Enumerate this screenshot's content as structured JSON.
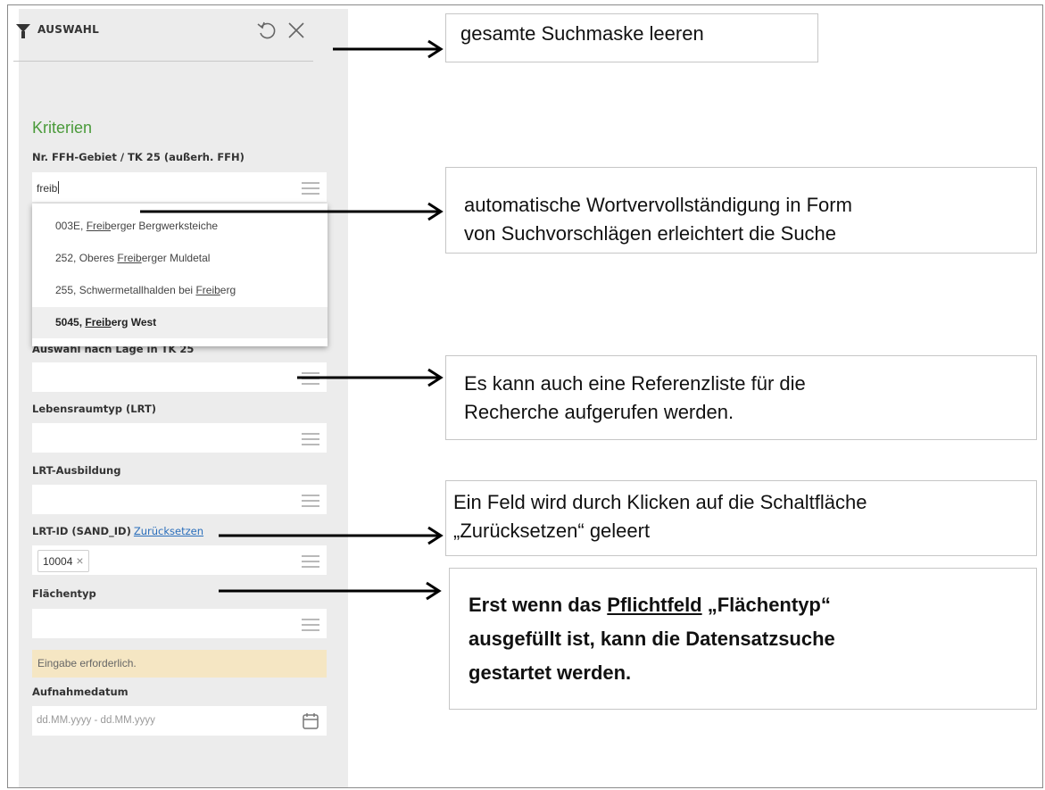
{
  "panel": {
    "title": "AUSWAHL",
    "section_title": "Kriterien"
  },
  "fields": {
    "ffh": {
      "label": "Nr. FFH-Gebiet / TK 25 (außerh. FFH)",
      "value": "freib"
    },
    "lage": {
      "label": "Auswahl nach Lage in TK 25"
    },
    "lrt": {
      "label": "Lebensraumtyp (LRT)"
    },
    "ausbildung": {
      "label": "LRT-Ausbildung"
    },
    "lrt_id": {
      "label": "LRT-ID (SAND_ID)",
      "reset_link": "Zurücksetzen",
      "chip": "10004",
      "chip_remove": "×"
    },
    "flaechentyp": {
      "label": "Flächentyp"
    },
    "warning": "Eingabe erforderlich.",
    "aufnahmedatum": {
      "label": "Aufnahmedatum",
      "placeholder": "dd.MM.yyyy - dd.MM.yyyy"
    }
  },
  "suggestions": [
    {
      "prefix": "003E, ",
      "match": "Freib",
      "suffix": "erger Bergwerksteiche"
    },
    {
      "prefix": "252, Oberes ",
      "match": "Freib",
      "suffix": "erger Muldetal"
    },
    {
      "prefix": "255, Schwermetallhalden bei ",
      "match": "Freib",
      "suffix": "erg"
    },
    {
      "prefix": "5045, ",
      "match": "Freib",
      "suffix": "erg West"
    }
  ],
  "callouts": {
    "clear": "gesamte Suchmaske leeren",
    "autocomplete_line1": "automatische Wortvervollständigung in Form",
    "autocomplete_line2": "von Suchvorschlägen erleichtert die Suche",
    "reflist_line1": "Es kann auch eine Referenzliste für die",
    "reflist_line2": "Recherche aufgerufen werden.",
    "reset_line1": "Ein Feld wird durch Klicken auf die Schaltfläche",
    "reset_line2": "„Zurücksetzen“ geleert",
    "required_pre": "Erst wenn das ",
    "required_word": "Pflichtfeld",
    "required_post": " „Flächentyp“",
    "required_line2": "ausgefüllt ist, kann die Datensatzsuche",
    "required_line3": "gestartet werden."
  }
}
